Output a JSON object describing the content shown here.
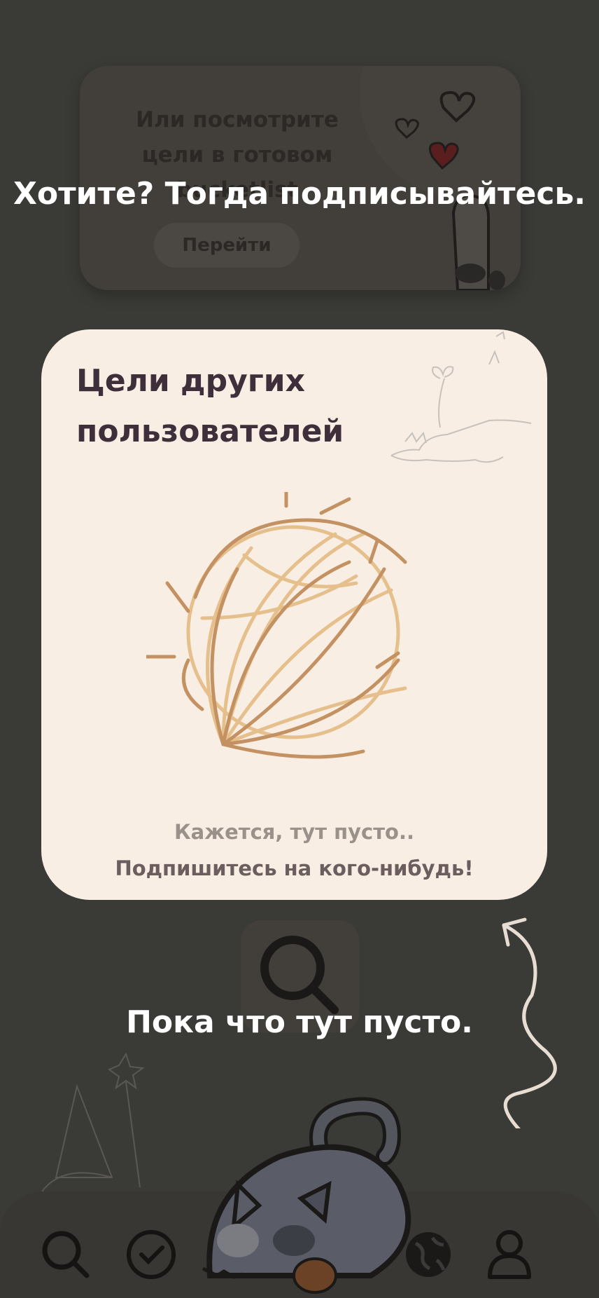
{
  "background_card": {
    "text": "Или посмотрите цели в готовом bucketlist",
    "button_label": "Перейти"
  },
  "overlay": {
    "top_text": "Хотите? Тогда подписывайтесь.",
    "bottom_text": "Пока что тут пусто."
  },
  "goals_card": {
    "title": "Цели других пользователей",
    "empty_line1": "Кажется, тут пусто..",
    "empty_line2": "Подпишитесь на кого-нибудь!"
  },
  "bottom_nav": {
    "icons": [
      "search-icon",
      "check-circle-icon",
      "globe-icon",
      "profile-icon"
    ]
  },
  "colors": {
    "overlay_bg": "#3a3a37",
    "card_bg": "#f8eee4",
    "title": "#3e2f3a",
    "muted_text": "#9a918a"
  }
}
